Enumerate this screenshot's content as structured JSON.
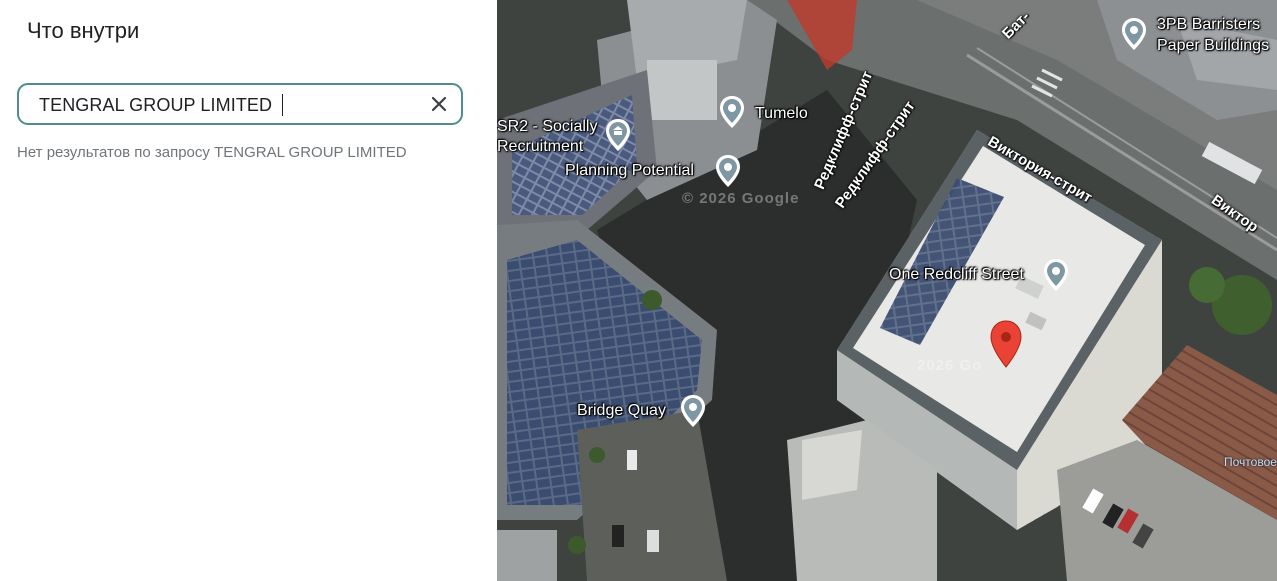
{
  "panel": {
    "title": "Что внутри",
    "search": {
      "value": "TENGRAL GROUP LIMITED"
    },
    "no_results": "Нет результатов по запросу TENGRAL GROUP LIMITED",
    "clear_icon": "close-icon"
  },
  "map": {
    "pois": [
      {
        "name": "Tumelo",
        "icon": "place-pin-icon"
      },
      {
        "name": "SR2 - Socially",
        "icon": "bank-icon"
      },
      {
        "name": "Recruitment",
        "icon": ""
      },
      {
        "name": "Planning Potential",
        "icon": "place-pin-icon"
      },
      {
        "name": "One Redcliff Street",
        "icon": "place-pin-icon"
      },
      {
        "name": "Bridge Quay",
        "icon": "place-pin-icon"
      },
      {
        "name": "3PB Barristers",
        "icon": "place-pin-icon"
      },
      {
        "name": "Paper Buildings",
        "icon": ""
      }
    ],
    "streets": [
      "Редклифф-стрит",
      "Редклифф-стрит",
      "Виктория-стрит",
      "Виктор",
      "Бат-"
    ],
    "misc_label": "Почтовое",
    "watermarks": [
      "© 2026 Google",
      "2026 Go"
    ],
    "selected_marker": "red-location-pin-icon",
    "colors": {
      "accent_border": "#4e8c8f",
      "selected_pin": "#ea4335"
    }
  }
}
